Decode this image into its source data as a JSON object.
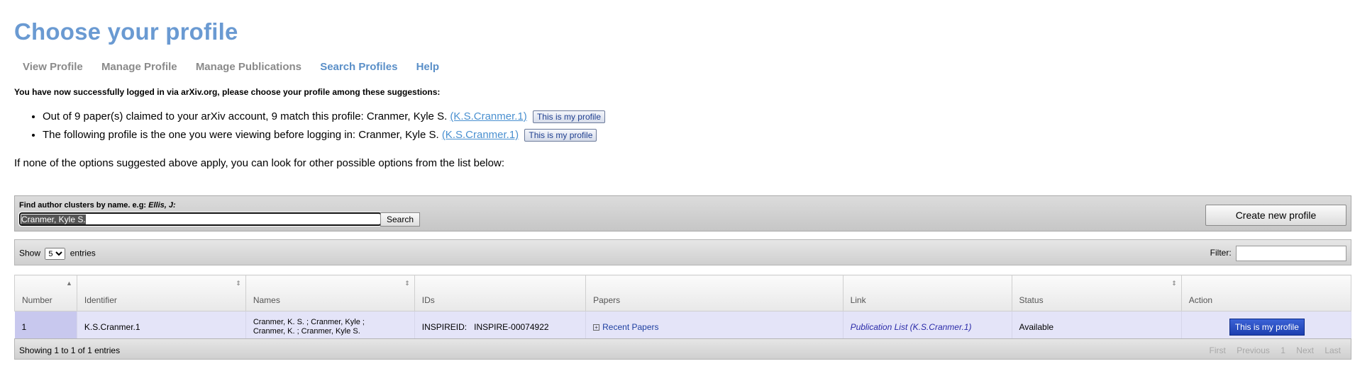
{
  "title": "Choose your profile",
  "nav": [
    "View Profile",
    "Manage Profile",
    "Manage Publications",
    "Search Profiles",
    "Help"
  ],
  "notice": "You have now successfully logged in via arXiv.org, please choose your profile among these suggestions:",
  "suggestions": [
    {
      "text": "Out of 9 paper(s) claimed to your arXiv account, 9 match this profile: Cranmer, Kyle S.",
      "link": "(K.S.Cranmer.1)",
      "button": "This is my profile"
    },
    {
      "text": "The following profile is the one you were viewing before logging in: Cranmer, Kyle S.",
      "link": "(K.S.Cranmer.1)",
      "button": "This is my profile"
    }
  ],
  "hint": "If none of the options suggested above apply, you can look for other possible options from the list below:",
  "search": {
    "label": "Find author clusters by name. e.g:",
    "example": "Ellis, J:",
    "value": "Cranmer, Kyle S.",
    "button": "Search",
    "create_button": "Create new profile"
  },
  "toolbar": {
    "show": "Show",
    "entries_value": "5",
    "entries": "entries",
    "filter": "Filter:"
  },
  "table": {
    "headers": [
      "Number",
      "Identifier",
      "Names",
      "IDs",
      "Papers",
      "Link",
      "Status",
      "Action"
    ],
    "row": {
      "number": "1",
      "identifier": "K.S.Cranmer.1",
      "names_line1": "Cranmer, K. S. ;  Cranmer, Kyle ;",
      "names_line2": "Cranmer, K. ;  Cranmer, Kyle S.",
      "ids": "INSPIREID:   INSPIRE-00074922",
      "papers": "Recent Papers",
      "link": "Publication List (K.S.Cranmer.1)",
      "status": "Available",
      "action": "This is my profile"
    }
  },
  "footer": {
    "info": "Showing 1 to 1 of 1 entries",
    "pager": [
      "First",
      "Previous",
      "1",
      "Next",
      "Last"
    ]
  },
  "colors": {
    "title": "#6a9ad2",
    "active_nav": "#5a8fc8",
    "row_bg": "#e4e4f8",
    "action_button": "#1d3fb0"
  }
}
